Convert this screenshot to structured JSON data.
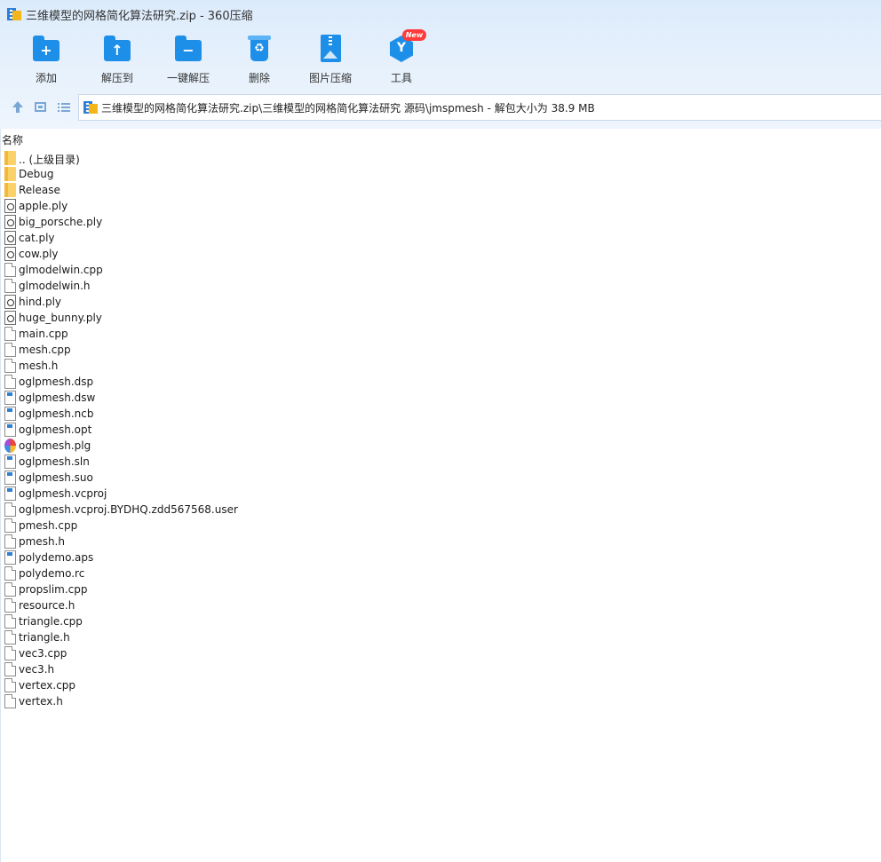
{
  "window": {
    "title": "三维模型的网格简化算法研究.zip - 360压缩"
  },
  "toolbar": {
    "add": "添加",
    "extract_to": "解压到",
    "one_click_extract": "一键解压",
    "delete": "删除",
    "image_compress": "图片压缩",
    "tools": "工具",
    "new_badge": "New"
  },
  "address": {
    "path": "三维模型的网格简化算法研究.zip\\三维模型的网格简化算法研究 源码\\jmspmesh - 解包大小为 38.9 MB"
  },
  "column": {
    "name": "名称"
  },
  "files": [
    {
      "name": ".. (上级目录)",
      "icon": "folder-icon"
    },
    {
      "name": "Debug",
      "icon": "folder-icon"
    },
    {
      "name": "Release",
      "icon": "folder-icon"
    },
    {
      "name": "apple.ply",
      "icon": "ply-file-icon"
    },
    {
      "name": "big_porsche.ply",
      "icon": "ply-file-icon"
    },
    {
      "name": "cat.ply",
      "icon": "ply-file-icon"
    },
    {
      "name": "cow.ply",
      "icon": "ply-file-icon"
    },
    {
      "name": "glmodelwin.cpp",
      "icon": "document-icon"
    },
    {
      "name": "glmodelwin.h",
      "icon": "document-icon"
    },
    {
      "name": "hind.ply",
      "icon": "ply-file-icon"
    },
    {
      "name": "huge_bunny.ply",
      "icon": "ply-file-icon"
    },
    {
      "name": "main.cpp",
      "icon": "document-icon"
    },
    {
      "name": "mesh.cpp",
      "icon": "document-icon"
    },
    {
      "name": "mesh.h",
      "icon": "document-icon"
    },
    {
      "name": "oglpmesh.dsp",
      "icon": "document-icon"
    },
    {
      "name": "oglpmesh.dsw",
      "icon": "vs-file-icon"
    },
    {
      "name": "oglpmesh.ncb",
      "icon": "vs-file-icon"
    },
    {
      "name": "oglpmesh.opt",
      "icon": "vs-file-icon"
    },
    {
      "name": "oglpmesh.plg",
      "icon": "color-app-icon"
    },
    {
      "name": "oglpmesh.sln",
      "icon": "vs-file-icon"
    },
    {
      "name": "oglpmesh.suo",
      "icon": "vs-file-icon"
    },
    {
      "name": "oglpmesh.vcproj",
      "icon": "vs-file-icon"
    },
    {
      "name": "oglpmesh.vcproj.BYDHQ.zdd567568.user",
      "icon": "document-icon"
    },
    {
      "name": "pmesh.cpp",
      "icon": "document-icon"
    },
    {
      "name": "pmesh.h",
      "icon": "document-icon"
    },
    {
      "name": "polydemo.aps",
      "icon": "vs-file-icon"
    },
    {
      "name": "polydemo.rc",
      "icon": "document-icon"
    },
    {
      "name": "propslim.cpp",
      "icon": "document-icon"
    },
    {
      "name": "resource.h",
      "icon": "document-icon"
    },
    {
      "name": "triangle.cpp",
      "icon": "document-icon"
    },
    {
      "name": "triangle.h",
      "icon": "document-icon"
    },
    {
      "name": "vec3.cpp",
      "icon": "document-icon"
    },
    {
      "name": "vec3.h",
      "icon": "document-icon"
    },
    {
      "name": "vertex.cpp",
      "icon": "document-icon"
    },
    {
      "name": "vertex.h",
      "icon": "document-icon"
    }
  ]
}
